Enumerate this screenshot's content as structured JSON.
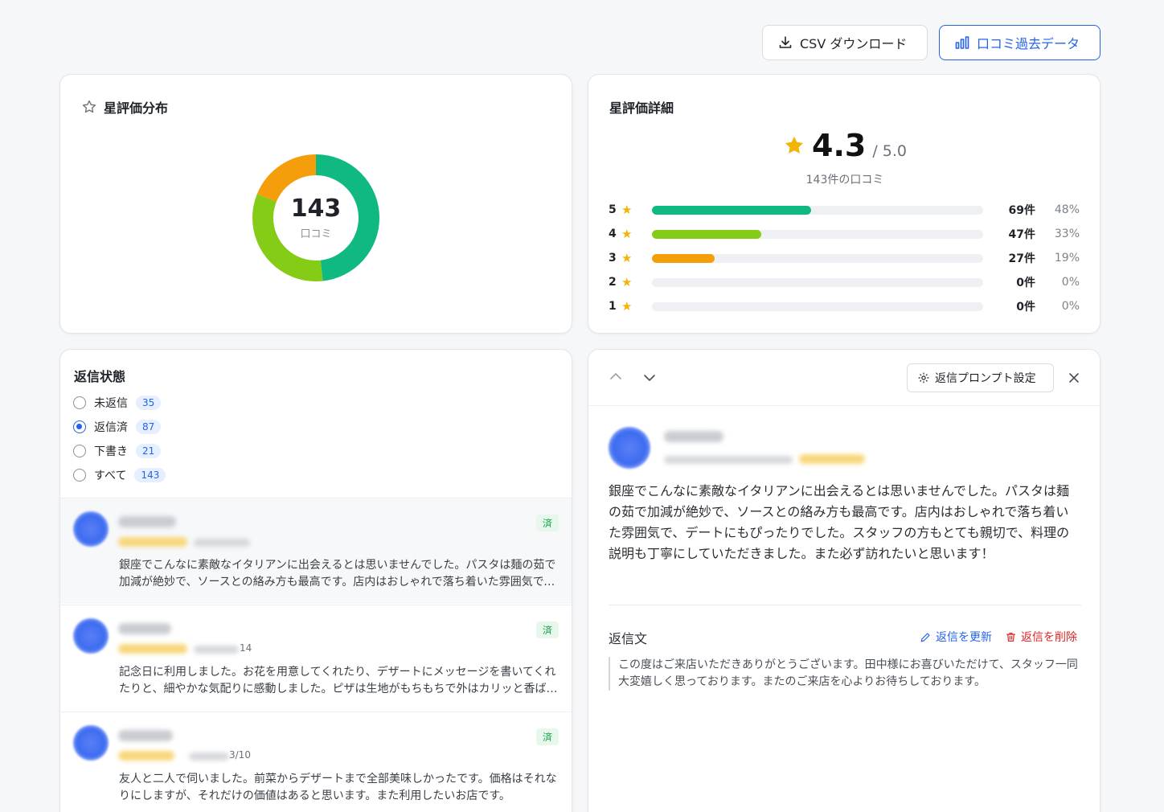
{
  "toolbar": {
    "csv_label": "CSV ダウンロード",
    "history_label": "口コミ過去データ"
  },
  "distribution": {
    "title": "星評価分布",
    "total": "143",
    "total_label": "口コミ",
    "segments": [
      {
        "stars": 5,
        "count": 69,
        "color": "#10b981"
      },
      {
        "stars": 4,
        "count": 47,
        "color": "#84cc16"
      },
      {
        "stars": 3,
        "count": 27,
        "color": "#f59e0b"
      }
    ]
  },
  "detail": {
    "title": "星評価詳細",
    "average": "4.3",
    "max": "/ 5.0",
    "count_text": "143件の口コミ",
    "rows": [
      {
        "label": "5",
        "count": "69件",
        "pct": "48%",
        "ratio": 0.48,
        "color": "#10b981"
      },
      {
        "label": "4",
        "count": "47件",
        "pct": "33%",
        "ratio": 0.33,
        "color": "#84cc16"
      },
      {
        "label": "3",
        "count": "27件",
        "pct": "19%",
        "ratio": 0.19,
        "color": "#f59e0b"
      },
      {
        "label": "2",
        "count": "0件",
        "pct": "0%",
        "ratio": 0,
        "color": "#e5e7eb"
      },
      {
        "label": "1",
        "count": "0件",
        "pct": "0%",
        "ratio": 0,
        "color": "#e5e7eb"
      }
    ]
  },
  "status": {
    "title": "返信状態",
    "options": [
      {
        "label": "未返信",
        "count": "35",
        "selected": false
      },
      {
        "label": "返信済",
        "count": "87",
        "selected": true
      },
      {
        "label": "下書き",
        "count": "21",
        "selected": false
      },
      {
        "label": "すべて",
        "count": "143",
        "selected": false
      }
    ]
  },
  "list": [
    {
      "badge": "済",
      "date_suffix": "",
      "text": "銀座でこんなに素敵なイタリアンに出会えるとは思いませんでした。パスタは麺の茹で加減が絶妙で、ソースとの絡み方も最高です。店内はおしゃれで落ち着いた雰囲気で、デートにもぴったりでした。"
    },
    {
      "badge": "済",
      "date_suffix": "14",
      "text": "記念日に利用しました。お花を用意してくれたり、デザートにメッセージを書いてくれたりと、細やかな気配りに感動しました。ピザは生地がもちもちで外はカリッと香ばしく最高でした。"
    },
    {
      "badge": "済",
      "date_suffix": "3/10",
      "text": "友人と二人で伺いました。前菜からデザートまで全部美味しかったです。価格はそれなりにしますが、それだけの価値はあると思います。また利用したいお店です。"
    }
  ],
  "review": {
    "prompt_label": "返信プロンプト設定",
    "body": "銀座でこんなに素敵なイタリアンに出会えるとは思いませんでした。パスタは麺の茹で加減が絶妙で、ソースとの絡み方も最高です。店内はおしゃれで落ち着いた雰囲気で、デートにもぴったりでした。スタッフの方もとても親切で、料理の説明も丁寧にしていただきました。また必ず訪れたいと思います！",
    "reply_label": "返信文",
    "update_label": "返信を更新",
    "delete_label": "返信を削除",
    "reply_text": "この度はご来店いただきありがとうございます。田中様にお喜びいただけて、スタッフ一同大変嬉しく思っております。またのご来店を心よりお待ちしております。"
  }
}
